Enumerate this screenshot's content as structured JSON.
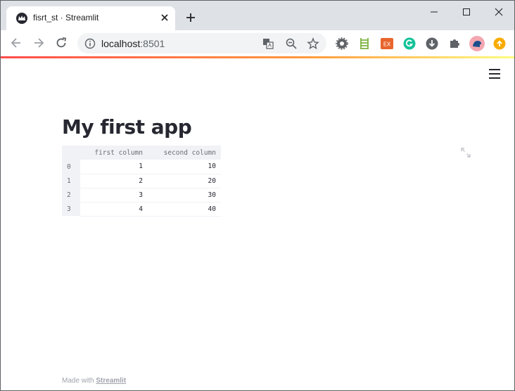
{
  "browser": {
    "tab": {
      "title": "fisrt_st · Streamlit"
    },
    "address": {
      "host": "localhost",
      "port": ":8501"
    },
    "extensions": [
      "settings-gear-icon",
      "ladder-icon",
      "ex-icon",
      "grammarly-icon",
      "download-icon",
      "puzzle-icon",
      "profile-avatar-icon",
      "update-icon"
    ]
  },
  "app": {
    "title": "My first app",
    "dataframe": {
      "columns": [
        "first column",
        "second column"
      ],
      "rows": [
        {
          "index": "0",
          "values": [
            "1",
            "10"
          ]
        },
        {
          "index": "1",
          "values": [
            "2",
            "20"
          ]
        },
        {
          "index": "2",
          "values": [
            "3",
            "30"
          ]
        },
        {
          "index": "3",
          "values": [
            "4",
            "40"
          ]
        }
      ]
    },
    "footer": {
      "prefix": "Made with",
      "link": "Streamlit"
    }
  },
  "colors": {
    "accent": "#ff4b4b",
    "text": "#262730",
    "table_header_bg": "#f0f2f6",
    "tab_strip": "#dee1e6"
  }
}
